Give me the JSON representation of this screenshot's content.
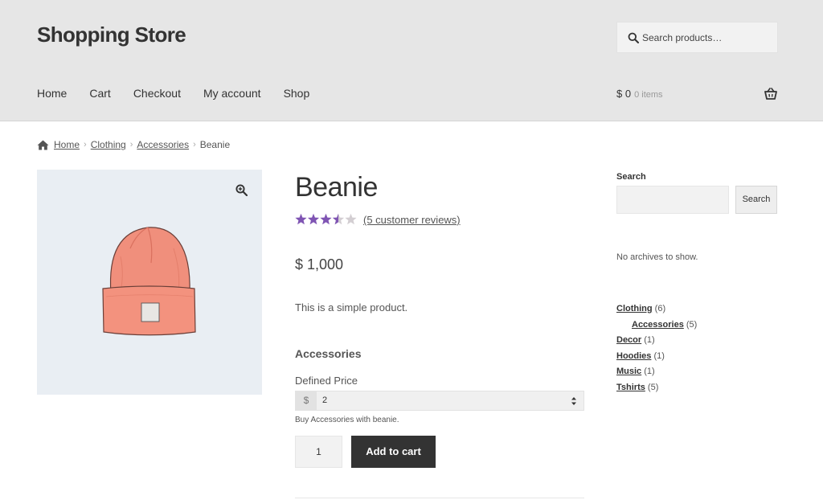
{
  "header": {
    "site_title": "Shopping Store",
    "search_placeholder": "Search products…",
    "nav": [
      "Home",
      "Cart",
      "Checkout",
      "My account",
      "Shop"
    ],
    "cart_amount": "$ 0",
    "cart_items": "0 items"
  },
  "breadcrumb": [
    "Home",
    "Clothing",
    "Accessories",
    "Beanie"
  ],
  "product": {
    "title": "Beanie",
    "rating": 3.5,
    "rating_max": 5,
    "star_color": "#7f54b3",
    "reviews_link": "(5 customer reviews)",
    "price": "$ 1,000",
    "short_description": "This is a simple product.",
    "addon_heading": "Accessories",
    "addon_label": "Defined Price",
    "addon_currency": "$",
    "addon_value": "2",
    "addon_description": "Buy Accessories with beanie.",
    "quantity": "1",
    "add_to_cart": "Add to cart"
  },
  "sidebar": {
    "search_label": "Search",
    "search_button": "Search",
    "no_archives": "No archives to show.",
    "categories": [
      {
        "name": "Clothing",
        "count": "(6)"
      },
      {
        "name": "Accessories",
        "count": "(5)"
      },
      {
        "name": "Decor",
        "count": "(1)"
      },
      {
        "name": "Hoodies",
        "count": "(1)"
      },
      {
        "name": "Music",
        "count": "(1)"
      },
      {
        "name": "Tshirts",
        "count": "(5)"
      }
    ]
  }
}
